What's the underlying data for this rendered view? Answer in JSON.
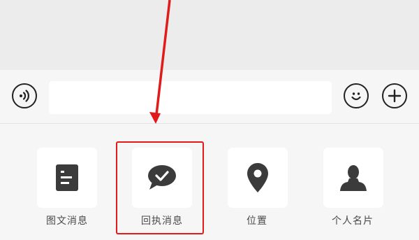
{
  "input_bar": {
    "voice_icon": "voice-wave-icon",
    "emoji_icon": "smiley-icon",
    "plus_icon": "plus-icon",
    "message_value": ""
  },
  "panel": {
    "items": [
      {
        "label": "图文消息",
        "icon": "document-icon"
      },
      {
        "label": "回执消息",
        "icon": "chat-check-icon"
      },
      {
        "label": "位置",
        "icon": "location-pin-icon"
      },
      {
        "label": "个人名片",
        "icon": "person-icon"
      }
    ]
  },
  "annotation": {
    "color": "#e11a1a",
    "target": "回执消息"
  },
  "colors": {
    "icon": "#3b3b3b",
    "panel_bg": "#f6f6f6",
    "tile_bg": "#ffffff",
    "chat_bg": "#ececec"
  }
}
